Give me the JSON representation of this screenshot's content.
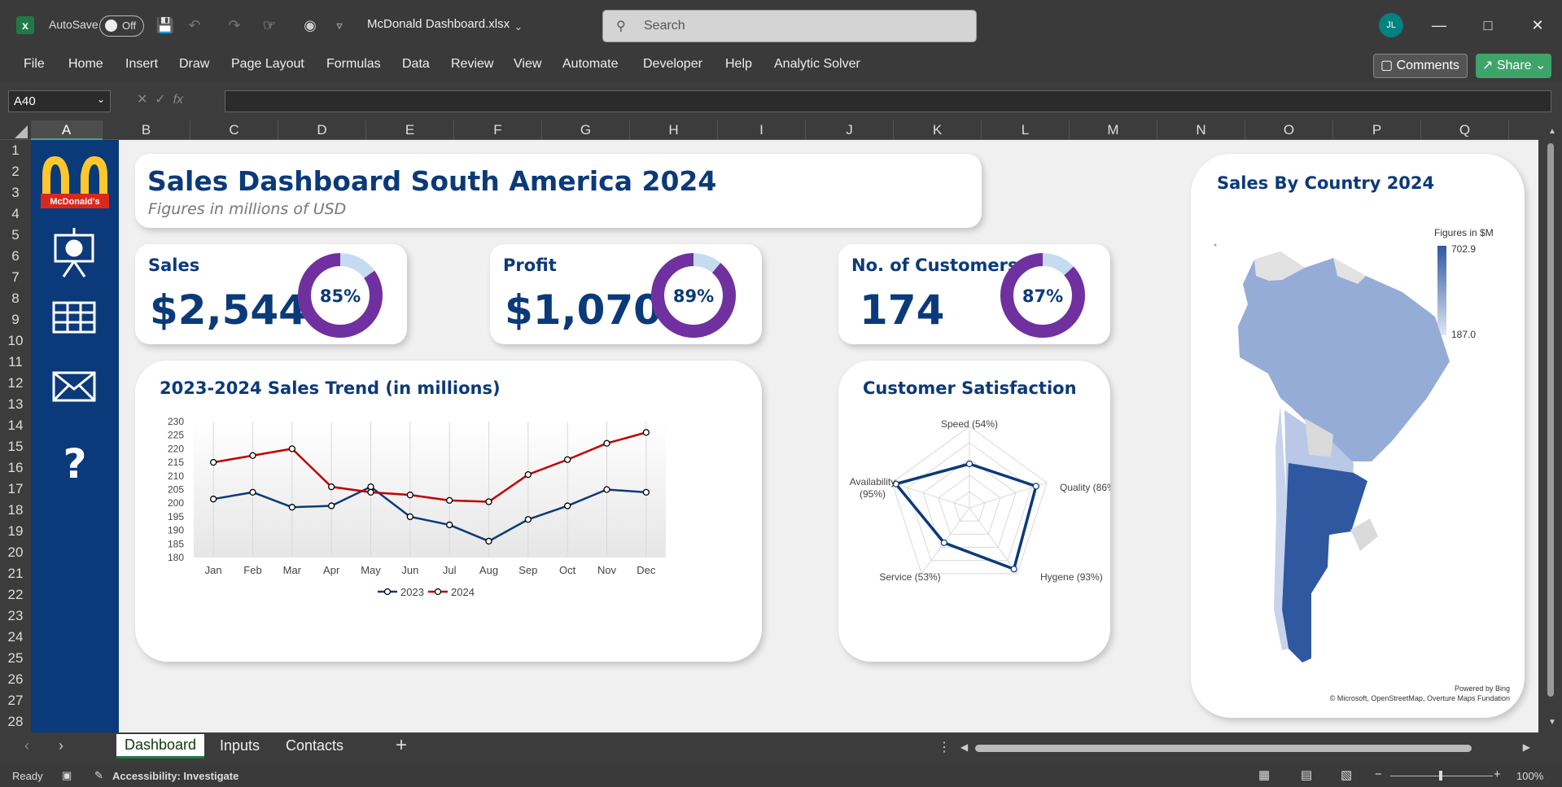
{
  "titlebar": {
    "autosave_label": "AutoSave",
    "toggle_label": "Off",
    "filename": "McDonald Dashboard.xlsx",
    "search_placeholder": "Search",
    "avatar_initials": "JL"
  },
  "menu": {
    "items": [
      "File",
      "Home",
      "Insert",
      "Draw",
      "Page Layout",
      "Formulas",
      "Data",
      "Review",
      "View",
      "Automate",
      "Developer",
      "Help",
      "Analytic Solver"
    ],
    "comments_label": "Comments",
    "share_label": "Share"
  },
  "formula_bar": {
    "name_box": "A40",
    "formula": ""
  },
  "columns": [
    "A",
    "B",
    "C",
    "D",
    "E",
    "F",
    "G",
    "H",
    "I",
    "J",
    "K",
    "L",
    "M",
    "N",
    "O",
    "P",
    "Q"
  ],
  "rows": [
    "1",
    "2",
    "3",
    "4",
    "5",
    "6",
    "7",
    "8",
    "9",
    "10",
    "11",
    "12",
    "13",
    "14",
    "15",
    "16",
    "17",
    "18",
    "19",
    "20",
    "21",
    "22",
    "23",
    "24",
    "25",
    "26",
    "27",
    "28"
  ],
  "sidebar": {
    "logo_text": "McDonald's",
    "icons": [
      "presentation-icon",
      "table-icon",
      "mail-icon",
      "help-icon"
    ]
  },
  "header": {
    "title": "Sales Dashboard South America 2024",
    "subtitle": "Figures in millions of USD"
  },
  "kpis": [
    {
      "label": "Sales",
      "value": "$2,544",
      "pct_text": "85%",
      "pct": 0.85
    },
    {
      "label": "Profit",
      "value": "$1,070",
      "pct_text": "89%",
      "pct": 0.89
    },
    {
      "label": "No. of Customers",
      "value": "174",
      "pct_text": "87%",
      "pct": 0.87
    }
  ],
  "colors": {
    "navy": "#0b3a7a",
    "purple": "#7030a0",
    "light_blue": "#c5dbf0",
    "red": "#c00000",
    "map_dark": "#2f58a0",
    "map_light": "#dfe6f3"
  },
  "chart_data": [
    {
      "type": "line",
      "title": "2023-2024 Sales Trend (in millions)",
      "categories": [
        "Jan",
        "Feb",
        "Mar",
        "Apr",
        "May",
        "Jun",
        "Jul",
        "Aug",
        "Sep",
        "Oct",
        "Nov",
        "Dec"
      ],
      "ylim": [
        180,
        230
      ],
      "yticks": [
        180,
        185,
        190,
        195,
        200,
        205,
        210,
        215,
        220,
        225,
        230
      ],
      "series": [
        {
          "name": "2023",
          "values": [
            201.5,
            204,
            198.5,
            199,
            206,
            195,
            192,
            186,
            194,
            199,
            205,
            204
          ]
        },
        {
          "name": "2024",
          "values": [
            215,
            217.5,
            220,
            206,
            204,
            203,
            201,
            200.5,
            210.5,
            216,
            222,
            226
          ]
        }
      ]
    },
    {
      "type": "radar",
      "title": "Customer Satisfaction",
      "categories": [
        "Speed (54%)",
        "Quality (86%)",
        "Hygene (93%)",
        "Service (53%)",
        "Availability\n(95%)"
      ],
      "values": [
        54,
        86,
        93,
        53,
        95
      ],
      "rmax": 100
    }
  ],
  "map": {
    "title": "Sales By Country 2024",
    "legend_title": "Figures in $M",
    "legend_max": "702.9",
    "legend_min": "187.0",
    "credit1": "Powered by Bing",
    "credit2": "© Microsoft, OpenStreetMap, Overture Maps Fundation"
  },
  "tabs": [
    "Dashboard",
    "Inputs",
    "Contacts"
  ],
  "status": {
    "ready": "Ready",
    "accessibility": "Accessibility: Investigate",
    "zoom": "100%"
  }
}
